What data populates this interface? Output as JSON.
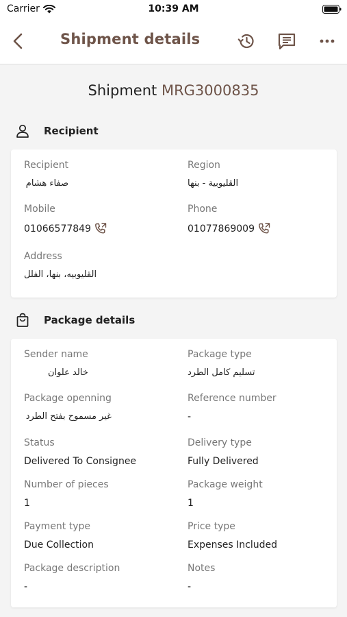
{
  "status_bar": {
    "carrier": "Carrier",
    "time": "10:39 AM"
  },
  "nav": {
    "title": "Shipment details"
  },
  "shipment": {
    "prefix": "Shipment",
    "code": "MRG3000835"
  },
  "recipient_section": {
    "title": "Recipient",
    "recipient_label": "Recipient",
    "recipient_value": "صفاء هشام",
    "region_label": "Region",
    "region_value": "القليوبية - بنها",
    "mobile_label": "Mobile",
    "mobile_value": "01066577849",
    "phone_label": "Phone",
    "phone_value": "01077869009",
    "address_label": "Address",
    "address_value": "القليوبيه، بنها، الفلل"
  },
  "package_section": {
    "title": "Package details",
    "sender_label": "Sender name",
    "sender_value": "خالد علوان",
    "package_type_label": "Package type",
    "package_type_value": "تسليم كامل الطرد",
    "opening_label": "Package openning",
    "opening_value": "غير مسموح بفتح الطرد",
    "reference_label": "Reference number",
    "reference_value": "-",
    "status_label": "Status",
    "status_value": "Delivered To Consignee",
    "delivery_type_label": "Delivery type",
    "delivery_type_value": "Fully Delivered",
    "pieces_label": "Number of pieces",
    "pieces_value": "1",
    "weight_label": "Package weight",
    "weight_value": "1",
    "payment_label": "Payment type",
    "payment_value": "Due Collection",
    "price_label": "Price type",
    "price_value": "Expenses Included",
    "description_label": "Package description",
    "description_value": "-",
    "notes_label": "Notes",
    "notes_value": "-"
  },
  "colors": {
    "accent": "#6e5449",
    "background": "#f4f4f4",
    "card": "#ffffff",
    "label": "#777777"
  },
  "icons": [
    "wifi-icon",
    "battery-icon",
    "back-chevron-icon",
    "history-icon",
    "comment-icon",
    "more-icon",
    "person-icon",
    "shopping-bag-icon",
    "phone-call-icon"
  ]
}
